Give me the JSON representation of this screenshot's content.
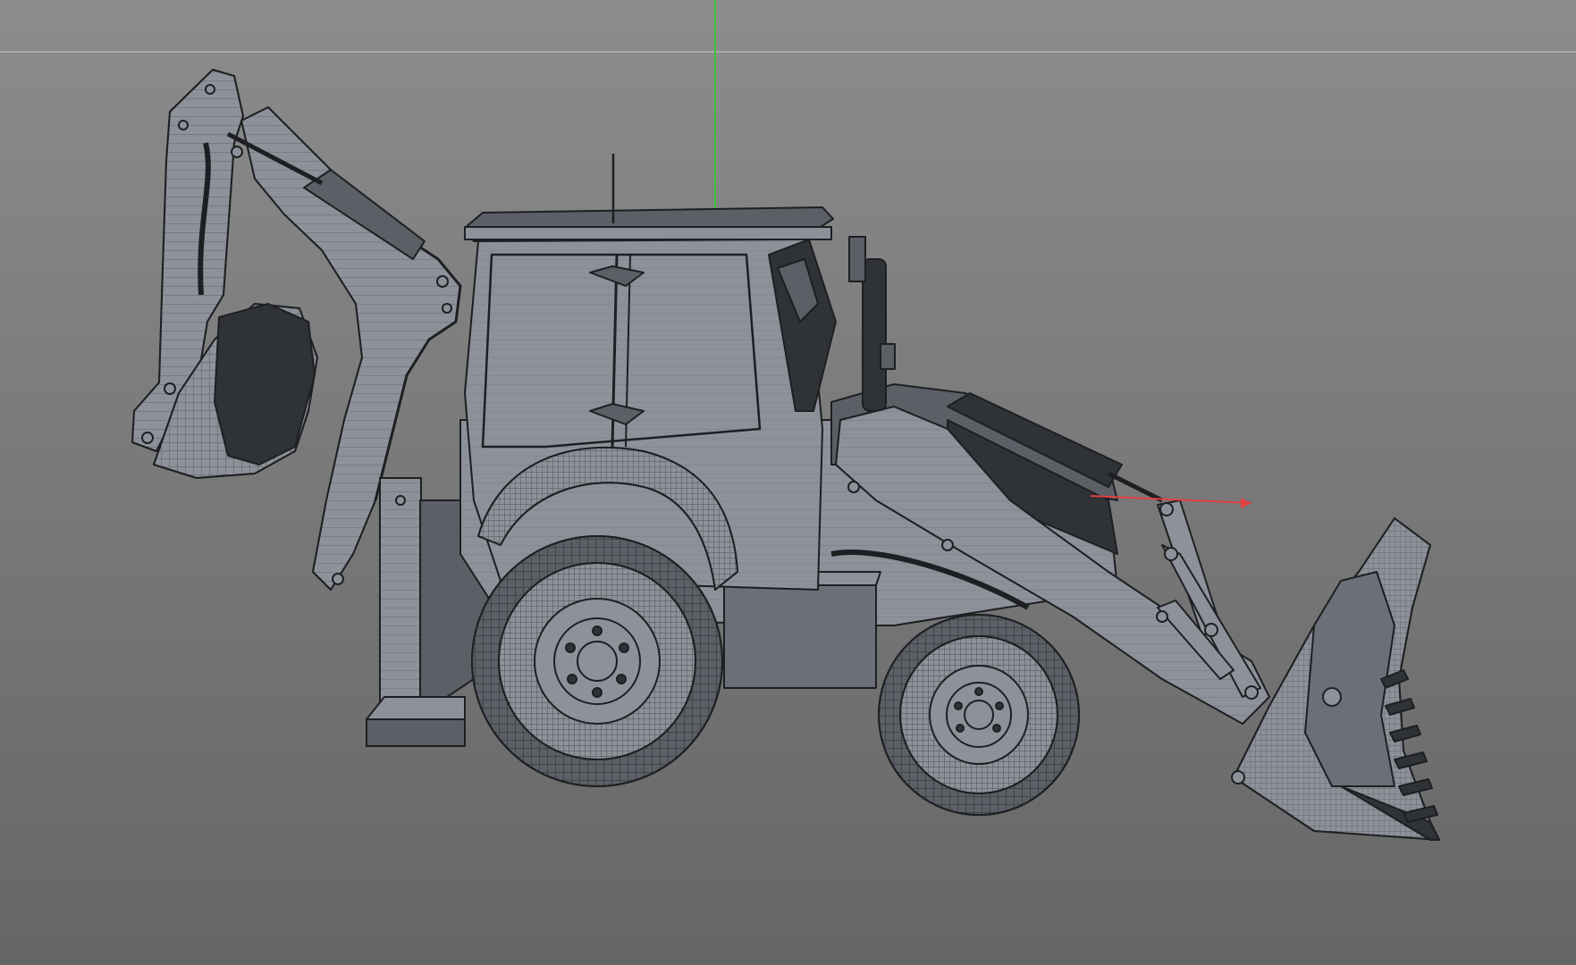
{
  "viewport": {
    "background_top": "#8c8c8c",
    "background_bottom": "#666666",
    "horizon_line_color": "#b4b4b4"
  },
  "axes": {
    "y_axis_color": "#3fbf3f",
    "x_axis_color": "#e04040"
  },
  "model": {
    "name": "backhoe-loader",
    "shaded_color": "#8d929a",
    "shadow_color": "#2f3236",
    "wire_color": "#1e1f22"
  }
}
